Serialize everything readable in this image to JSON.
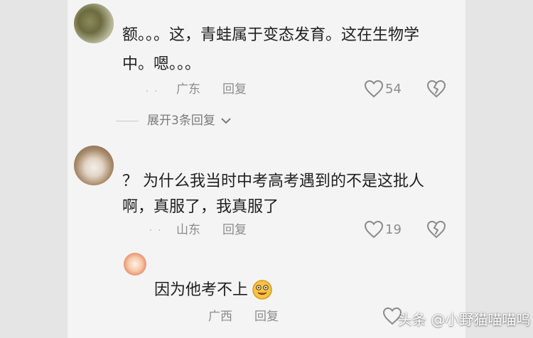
{
  "comments": [
    {
      "text_line1": "额。。。这，青蛙属于变态发育。这在生物学",
      "text_line2": "中。嗯。。。",
      "region": "广东",
      "reply_label": "回复",
      "likes": "54",
      "expand_label": "展开3条回复"
    },
    {
      "text_line1": "？ 为什么我当时中考高考遇到的不是这批人",
      "text_line2": "啊，真服了，我真服了",
      "region": "山东",
      "reply_label": "回复",
      "likes": "19"
    }
  ],
  "reply": {
    "text": "因为他考不上",
    "region": "广西",
    "reply_label": "回复"
  },
  "watermark": "头条 @小野猫喵喵呜",
  "icons": [
    "heart-outline-icon",
    "broken-heart-icon",
    "chevron-down-icon",
    "smiling-emoji-icon"
  ]
}
